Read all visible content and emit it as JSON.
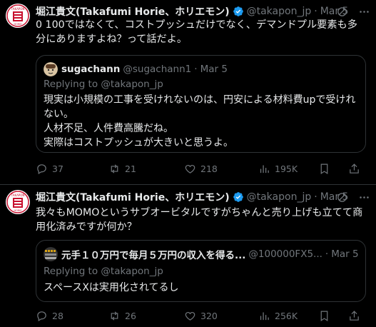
{
  "tweets": [
    {
      "author_name": "堀江貴文(Takafumi Horie、ホリエモン)",
      "handle": "@takapon_jp",
      "dot": "·",
      "date": "Mar 5",
      "text": "0 100ではなくて、コストプッシュだけでなく、デマンドプル要素も多分にありますよね？って話だよ。",
      "quote": {
        "author_name": "sugachann",
        "handle": "@sugachann1",
        "dot": "·",
        "date": "Mar 5",
        "replying_to": "Replying to @takapon_jp",
        "lines": [
          "現実は小規模の工事を受けれないのは、円安による材料費upで受けれない。",
          "人材不足、人件費高騰だね。",
          "実際はコストプッシュが大きいと思うよ。"
        ]
      },
      "actions": {
        "replies": "37",
        "reposts": "21",
        "likes": "218",
        "views": "195K"
      }
    },
    {
      "author_name": "堀江貴文(Takafumi Horie、ホリエモン)",
      "handle": "@takapon_jp",
      "dot": "·",
      "date": "Mar 5",
      "text": "我々もMOMOというサブオービタルですがちゃんと売り上げも立てて商用化済みですが何か？",
      "quote": {
        "author_name": "元手１０万円で毎月５万円の収入を得る...",
        "handle": "@100000FX5...",
        "dot": "·",
        "date": "Mar 5",
        "replying_to": "Replying to @takapon_jp",
        "lines": [
          "スペースXは実用化されてるし"
        ]
      },
      "actions": {
        "replies": "28",
        "reposts": "26",
        "likes": "320",
        "views": "256K"
      }
    }
  ],
  "colors": {
    "background": "#000000",
    "text": "#e7e9ea",
    "muted": "#71767b",
    "border": "#2f3336",
    "verified": "#1d9bf0"
  },
  "icons": [
    "verified-badge-icon",
    "grok-icon",
    "more-icon",
    "reply-icon",
    "repost-icon",
    "like-icon",
    "views-icon",
    "bookmark-icon",
    "share-icon"
  ]
}
